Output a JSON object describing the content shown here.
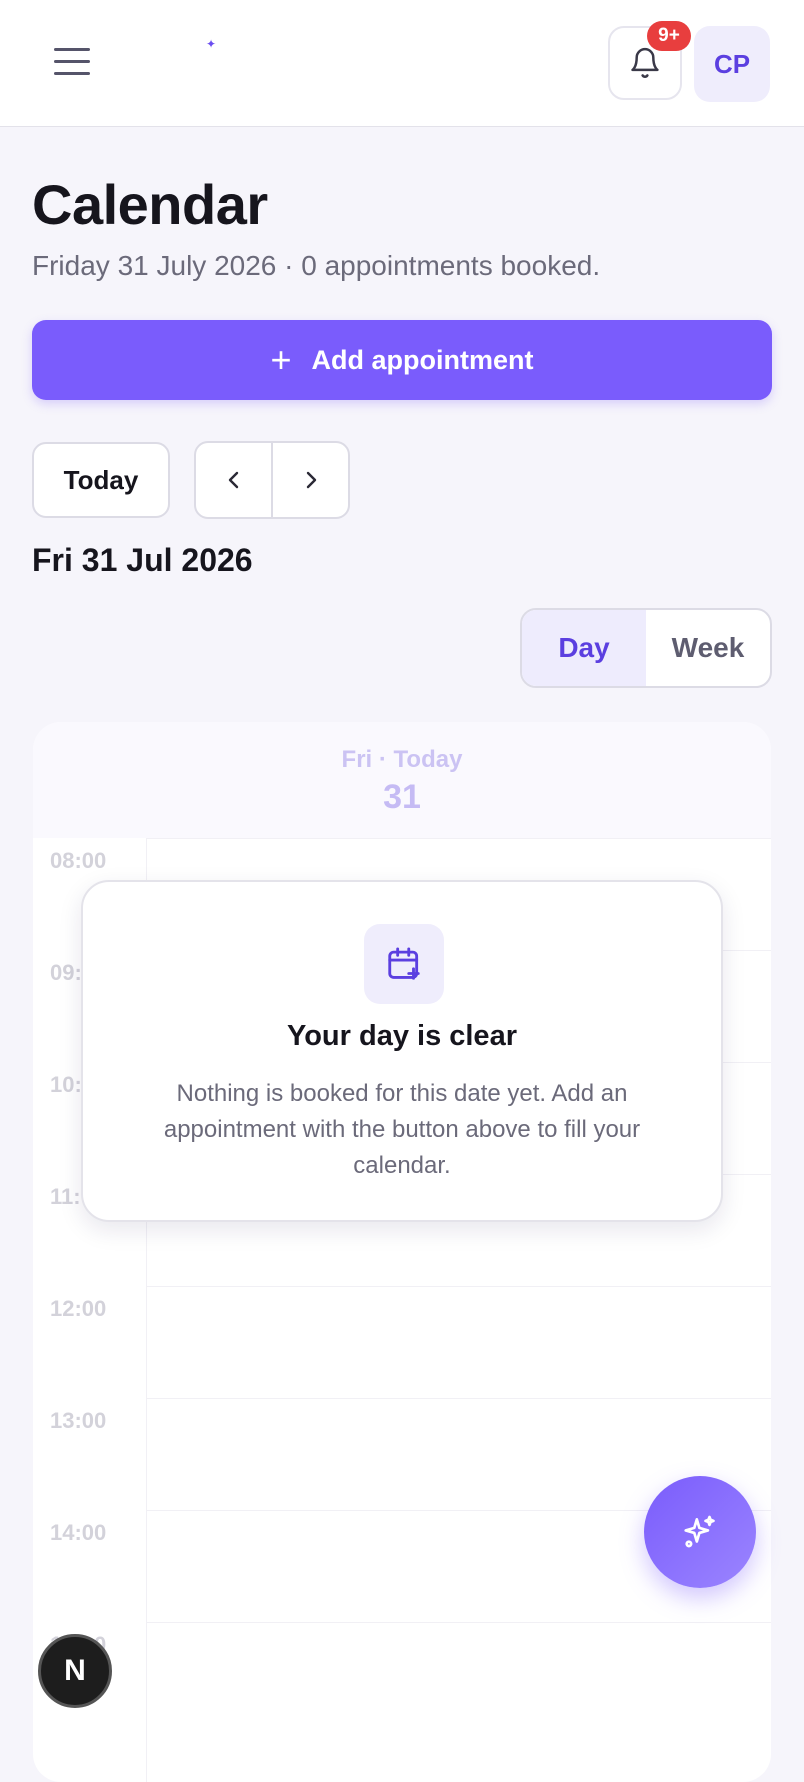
{
  "header": {
    "notifications_badge": "9+",
    "avatar_initials": "CP"
  },
  "page": {
    "title": "Calendar",
    "subtitle": "Friday 31 July 2026 · 0 appointments booked.",
    "add_button_label": "Add appointment",
    "today_button_label": "Today",
    "current_date": "Fri 31 Jul 2026",
    "view_options": {
      "day": "Day",
      "week": "Week",
      "selected": "Day"
    }
  },
  "calendar": {
    "column_day_label": "Fri · Today",
    "column_day_number": "31",
    "time_slots": [
      "08:00",
      "09:00",
      "10:00",
      "11:00",
      "12:00",
      "13:00",
      "14:00",
      "15:00"
    ]
  },
  "empty_state": {
    "title": "Your day is clear",
    "message": "Nothing is booked for this date yet. Add an appointment with the button above to fill your calendar."
  },
  "floating": {
    "assistant_icon": "sparkles-icon",
    "dev_badge": "N"
  },
  "colors": {
    "accent": "#7a5cfc",
    "accent_dark": "#5b3fe0",
    "badge": "#e83e3e"
  }
}
